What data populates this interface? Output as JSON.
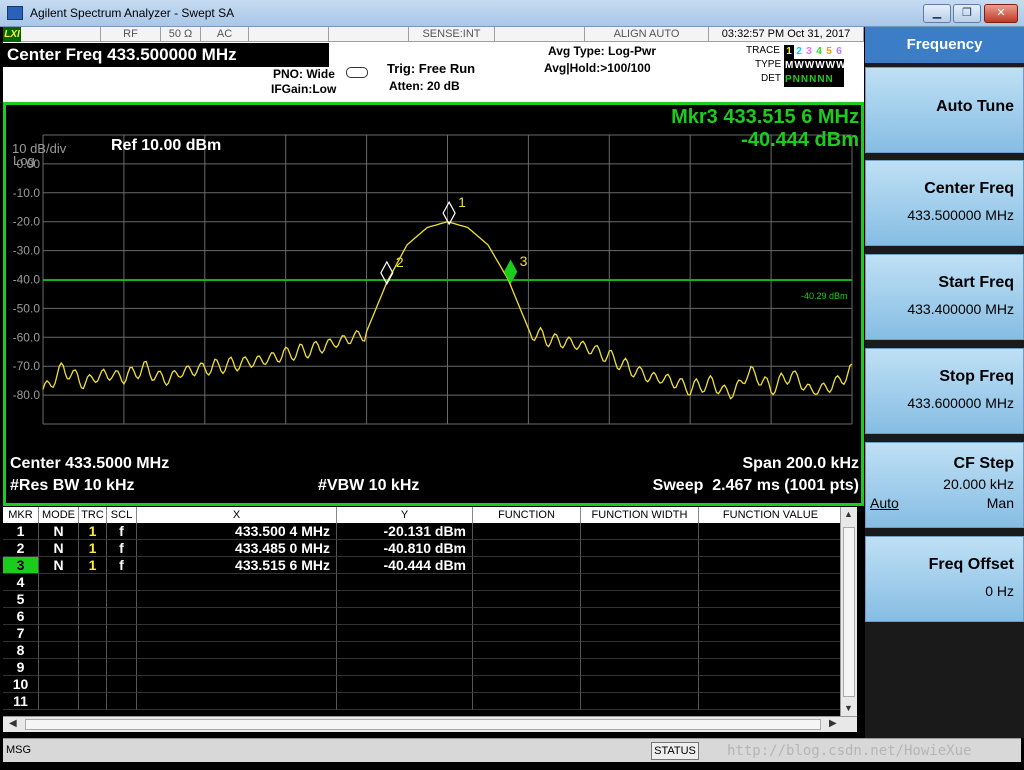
{
  "window": {
    "title": "Agilent Spectrum Analyzer - Swept SA",
    "min_glyph": "▁",
    "max_glyph": "❐",
    "close_glyph": "✕"
  },
  "status_bar": {
    "lxi": "LXI",
    "rf": "RF",
    "impedance": "50 Ω",
    "coupling": "AC",
    "sense": "SENSE:INT",
    "align": "ALIGN AUTO",
    "datetime": "03:32:57 PM Oct 31, 2017"
  },
  "header": {
    "center_freq_banner": "Center Freq 433.500000 MHz",
    "pno": "PNO: Wide",
    "ifgain": "IFGain:Low",
    "trig": "Trig: Free Run",
    "atten": "Atten: 20 dB",
    "avg_type": "Avg Type: Log-Pwr",
    "avg_hold": "Avg|Hold:>100/100",
    "trace_label": "TRACE",
    "type_label": "TYPE",
    "det_label": "DET",
    "trace_nums": [
      "1",
      "2",
      "3",
      "4",
      "5",
      "6"
    ],
    "type_row": "MWWWWW",
    "det_row": "PNNNNN"
  },
  "softkeys": {
    "title": "Frequency",
    "items": [
      {
        "label": "Auto Tune",
        "value": ""
      },
      {
        "label": "Center Freq",
        "value": "433.500000 MHz"
      },
      {
        "label": "Start Freq",
        "value": "433.400000 MHz"
      },
      {
        "label": "Stop Freq",
        "value": "433.600000 MHz"
      },
      {
        "label": "CF Step",
        "value": "20.000 kHz",
        "auto": "Auto",
        "man": "Man"
      },
      {
        "label": "Freq Offset",
        "value": "0 Hz"
      }
    ]
  },
  "graph": {
    "scale": "10 dB/div",
    "log": "Log",
    "ref": "Ref 10.00 dBm",
    "marker_readout_freq": "Mkr3 433.515 6 MHz",
    "marker_readout_amp": "-40.444 dBm",
    "display_line_label": "-40.29 dBm",
    "center": "Center 433.5000 MHz",
    "span": "Span 200.0 kHz",
    "rbw": "#Res BW 10 kHz",
    "vbw": "#VBW 10 kHz",
    "sweep": "Sweep  2.467 ms (1001 pts)"
  },
  "chart_data": {
    "type": "line",
    "title": "",
    "xlabel": "",
    "ylabel": "",
    "xlim": [
      433.4,
      433.6
    ],
    "ylim": [
      -90,
      10
    ],
    "y_tick_labels": [
      "0.00",
      "-10.0",
      "-20.0",
      "-30.0",
      "-40.0",
      "-50.0",
      "-60.0",
      "-70.0",
      "-80.0"
    ],
    "display_line": -40.29,
    "series": [
      {
        "x": [
          433.4,
          433.405,
          433.41,
          433.415,
          433.42,
          433.425,
          433.43,
          433.435,
          433.44,
          433.445,
          433.45,
          433.455,
          433.46,
          433.465,
          433.47,
          433.475,
          433.48,
          433.485,
          433.49,
          433.495,
          433.5,
          433.505,
          433.51,
          433.515,
          433.52,
          433.525,
          433.53,
          433.535,
          433.54,
          433.545,
          433.55,
          433.555,
          433.56,
          433.565,
          433.57,
          433.575,
          433.58,
          433.585,
          433.59,
          433.595,
          433.6
        ],
        "y": [
          -78,
          -70,
          -75,
          -72,
          -73,
          -70,
          -74,
          -71,
          -70,
          -69,
          -68,
          -67,
          -65,
          -64,
          -62,
          -60,
          -58,
          -41,
          -28,
          -22,
          -20,
          -22,
          -28,
          -40,
          -57,
          -60,
          -61,
          -63,
          -66,
          -70,
          -73,
          -74,
          -77,
          -75,
          -79,
          -71,
          -77,
          -72,
          -78,
          -76,
          -71
        ]
      }
    ],
    "markers": [
      {
        "n": "1",
        "x": 433.5004,
        "y": -20.131
      },
      {
        "n": "2",
        "x": 433.485,
        "y": -40.81
      },
      {
        "n": "3",
        "x": 433.5156,
        "y": -40.444
      }
    ]
  },
  "marker_table": {
    "headers": [
      "MKR",
      "MODE",
      "TRC",
      "SCL",
      "X",
      "Y",
      "FUNCTION",
      "FUNCTION WIDTH",
      "FUNCTION VALUE"
    ],
    "rows": [
      {
        "mkr": "1",
        "mode": "N",
        "trc": "1",
        "scl": "f",
        "x": "433.500 4 MHz",
        "y": "-20.131 dBm"
      },
      {
        "mkr": "2",
        "mode": "N",
        "trc": "1",
        "scl": "f",
        "x": "433.485 0 MHz",
        "y": "-40.810 dBm"
      },
      {
        "mkr": "3",
        "mode": "N",
        "trc": "1",
        "scl": "f",
        "x": "433.515 6 MHz",
        "y": "-40.444 dBm"
      },
      {
        "mkr": "4",
        "mode": "",
        "trc": "",
        "scl": "",
        "x": "",
        "y": ""
      },
      {
        "mkr": "5",
        "mode": "",
        "trc": "",
        "scl": "",
        "x": "",
        "y": ""
      },
      {
        "mkr": "6",
        "mode": "",
        "trc": "",
        "scl": "",
        "x": "",
        "y": ""
      },
      {
        "mkr": "7",
        "mode": "",
        "trc": "",
        "scl": "",
        "x": "",
        "y": ""
      },
      {
        "mkr": "8",
        "mode": "",
        "trc": "",
        "scl": "",
        "x": "",
        "y": ""
      },
      {
        "mkr": "9",
        "mode": "",
        "trc": "",
        "scl": "",
        "x": "",
        "y": ""
      },
      {
        "mkr": "10",
        "mode": "",
        "trc": "",
        "scl": "",
        "x": "",
        "y": ""
      },
      {
        "mkr": "11",
        "mode": "",
        "trc": "",
        "scl": "",
        "x": "",
        "y": ""
      }
    ]
  },
  "bottom": {
    "msg": "MSG",
    "status": "STATUS",
    "watermark": "http://blog.csdn.net/HowieXue"
  },
  "colors": {
    "trace": "#f0e030",
    "grid": "#6a6a6a",
    "border": "#1ccc1c",
    "display_line": "#1ccc1c",
    "marker_active": "#1ccc1c",
    "softkey": "#a9d1ef",
    "title_panel": "#3b7ec7"
  }
}
